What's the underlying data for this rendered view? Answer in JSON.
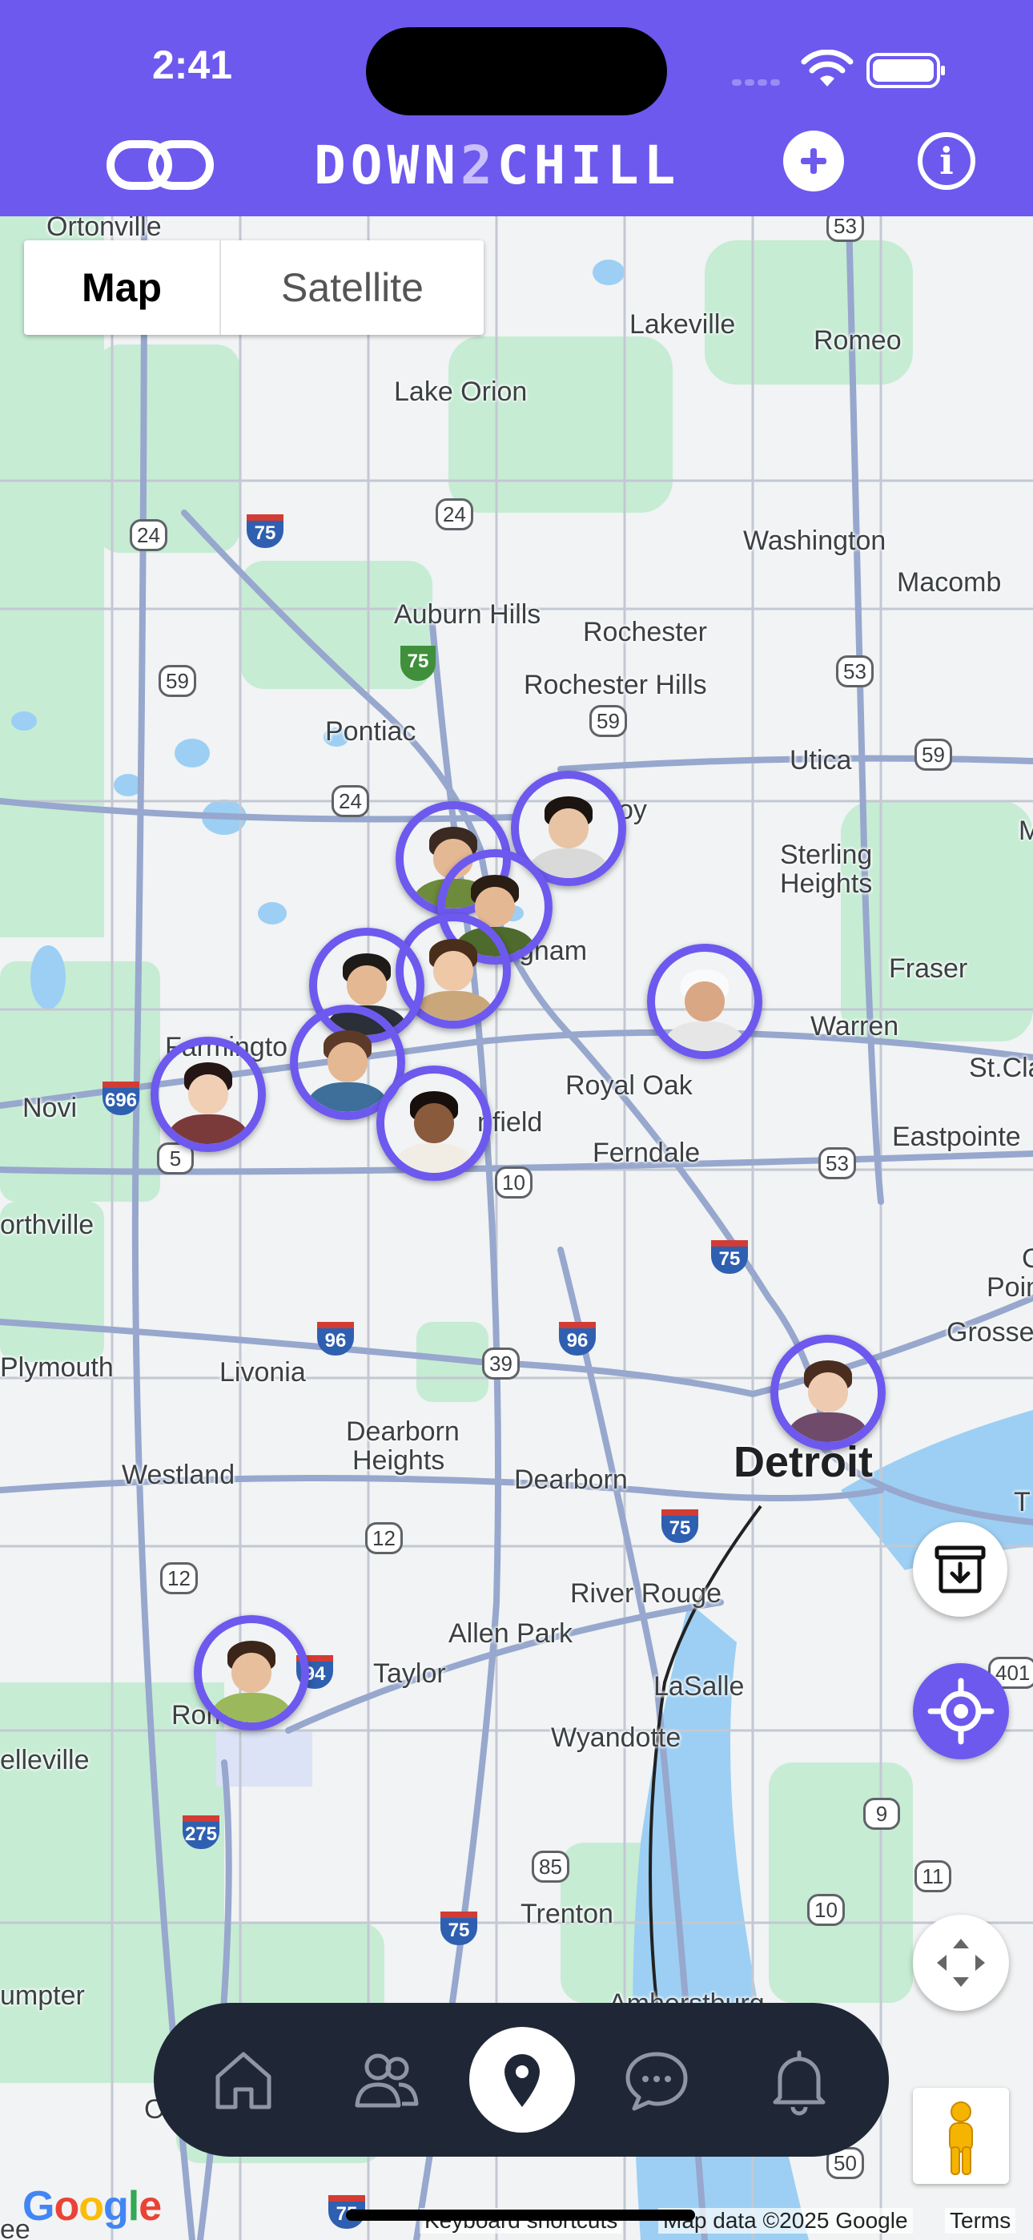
{
  "status": {
    "time": "2:41"
  },
  "header": {
    "brand_prefix": "DOWN",
    "brand_two": "2",
    "brand_suffix": "CHILL"
  },
  "map_type": {
    "map": "Map",
    "satellite": "Satellite"
  },
  "places": {
    "ortonville": "Ortonville",
    "lakeville": "Lakeville",
    "romeo": "Romeo",
    "lake_orion": "Lake Orion",
    "washington": "Washington",
    "macomb": "Macomb",
    "auburn_hills": "Auburn Hills",
    "rochester": "Rochester",
    "rochester_hills": "Rochester Hills",
    "pontiac": "Pontiac",
    "utica": "Utica",
    "troy": "oy",
    "sterling": "Sterling",
    "heights": "Heights",
    "m": "M",
    "birmingham": "gham",
    "fraser": "Fraser",
    "warren": "Warren",
    "st_clair": "St.Cla",
    "farmington": "Farmingto",
    "novi": "Novi",
    "royal_oak": "Royal Oak",
    "southfield": "nfield",
    "ferndale": "Ferndale",
    "eastpointe": "Eastpointe",
    "northville": "orthville",
    "poin": "Poin",
    "grosse": "Grosse",
    "c": "C",
    "plymouth": "Plymouth",
    "livonia": "Livonia",
    "dearborn_heights_1": "Dearborn",
    "dearborn_heights_2": "Heights",
    "westland": "Westland",
    "dearborn": "Dearborn",
    "detroit": "Detroit",
    "t": "T",
    "river_rouge": "River Rouge",
    "allen_park": "Allen Park",
    "taylor": "Taylor",
    "romulus": "Romul",
    "lasalle": "LaSalle",
    "belleville": "elleville",
    "wyandotte": "Wyandotte",
    "trenton": "Trenton",
    "sumpter": "umpter",
    "amherstburg": "Amherstburg",
    "o": "O",
    "ee": "ee"
  },
  "road_shields": {
    "r53a": "53",
    "r24a": "24",
    "r24b": "24",
    "r59a": "59",
    "r59b": "59",
    "r53b": "53",
    "r59c": "59",
    "r24c": "24",
    "r5": "5",
    "r10": "10",
    "r53c": "53",
    "r39": "39",
    "r12a": "12",
    "r12b": "12",
    "r85": "85",
    "r9": "9",
    "r11": "11",
    "r10b": "10",
    "r401": "401",
    "r50": "50"
  },
  "interstates": {
    "i75a": "75",
    "i696": "696",
    "i75b": "75",
    "i96a": "96",
    "i96b": "96",
    "i75c": "75",
    "i94": "94",
    "i275": "275",
    "i75d": "75",
    "i75e": "75"
  },
  "us_routes": {
    "us75": "75"
  },
  "attribution": {
    "google": [
      "G",
      "o",
      "o",
      "g",
      "l",
      "e"
    ],
    "keyboard": "Keyboard shortcuts",
    "map_data": "Map data ©2025 Google",
    "terms": "Terms"
  },
  "colors": {
    "accent": "#6d59ee",
    "tabbar": "#1f2737",
    "water": "#9ccff3",
    "park": "#c6ecd4"
  },
  "icons": {
    "link": "link-icon",
    "add": "plus-icon",
    "info": "info-icon",
    "archive": "archive-download-icon",
    "locate": "crosshair-icon",
    "fullscreen": "fullscreen-icon",
    "pegman": "pegman-icon",
    "home": "home-icon",
    "friends": "people-icon",
    "map": "map-pin-icon",
    "chat": "chat-icon",
    "bell": "bell-icon"
  }
}
